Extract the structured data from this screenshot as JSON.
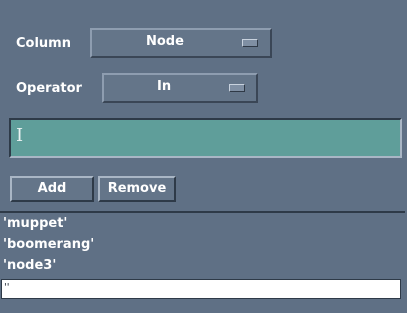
{
  "column": {
    "label": "Column",
    "selected": "Node"
  },
  "operator": {
    "label": "Operator",
    "selected": "In"
  },
  "value_field": {
    "value": ""
  },
  "buttons": {
    "add": "Add",
    "remove": "Remove"
  },
  "list": {
    "items": [
      "'muppet'",
      "'boomerang'",
      "'node3'",
      "''"
    ],
    "selected_index": 3
  },
  "colors": {
    "background": "#5f7085",
    "text_field": "#5f9e9a",
    "selected_row": "#ffffff"
  }
}
